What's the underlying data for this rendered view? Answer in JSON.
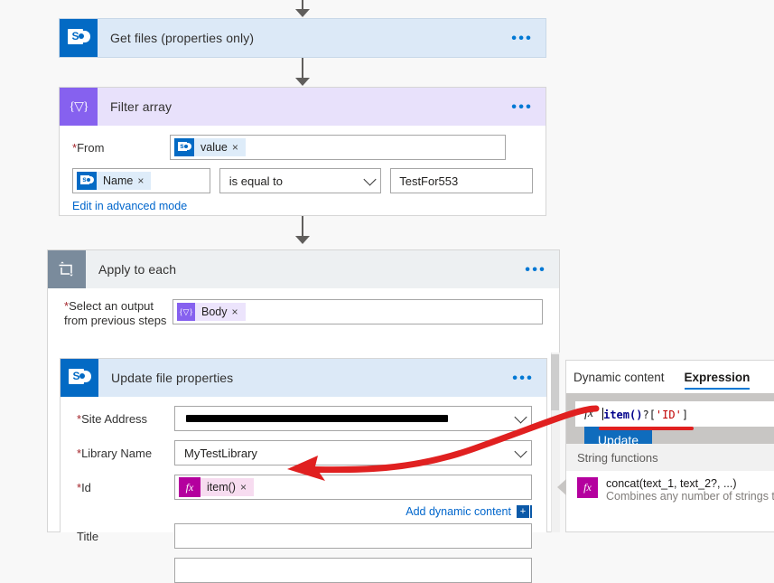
{
  "flow": {
    "steps": [
      {
        "id": "get-files",
        "title": "Get files (properties only)",
        "icon": "sharepoint-icon",
        "menu": "•••"
      },
      {
        "id": "filter-array",
        "title": "Filter array",
        "icon": "filter-array-icon",
        "menu": "•••",
        "from_label": "From",
        "from_required": "*",
        "from_chip": {
          "icon": "sharepoint-icon",
          "label": "value",
          "remove": "×"
        },
        "condition": {
          "left_chip": {
            "icon": "sharepoint-icon",
            "label": "Name",
            "remove": "×"
          },
          "operator": "is equal to",
          "operator_icon": "chevron-down-icon",
          "value": "TestFor553"
        },
        "advanced_link": "Edit in advanced mode"
      },
      {
        "id": "apply-to-each",
        "title": "Apply to each",
        "icon": "loop-icon",
        "menu": "•••",
        "select_label_line1": "Select an output",
        "select_label_line2": "from previous steps",
        "select_required": "*",
        "select_chip": {
          "icon": "filter-array-icon",
          "label": "Body",
          "remove": "×"
        }
      },
      {
        "id": "update-file-properties",
        "title": "Update file properties",
        "icon": "sharepoint-icon",
        "menu": "•••",
        "fields": [
          {
            "label": "Site Address",
            "required": "*",
            "value": "",
            "redacted": true,
            "control": "dropdown",
            "control_icon": "chevron-down-icon"
          },
          {
            "label": "Library Name",
            "required": "*",
            "value": "MyTestLibrary",
            "redacted": false,
            "control": "dropdown",
            "control_icon": "chevron-down-icon"
          },
          {
            "label": "Id",
            "required": "*",
            "value": "",
            "redacted": false,
            "control": "token",
            "token": {
              "icon": "fx-icon",
              "label": "item()",
              "remove": "×"
            }
          },
          {
            "label": "Title",
            "required": "",
            "value": "",
            "redacted": false,
            "control": "text"
          },
          {
            "label": "",
            "required": "",
            "value": "",
            "redacted": false,
            "control": "text"
          }
        ],
        "add_dynamic_content": "Add dynamic content",
        "add_dynamic_content_icon": "add-plus-icon"
      }
    ]
  },
  "panel": {
    "tabs": [
      {
        "label": "Dynamic content",
        "active": false
      },
      {
        "label": "Expression",
        "active": true
      }
    ],
    "expression": {
      "fx_icon": "fx-icon",
      "full_text": "item()?['ID']",
      "tokens": [
        {
          "text": "item()",
          "kind": "function"
        },
        {
          "text": "?[",
          "kind": "punctuation"
        },
        {
          "text": "'ID'",
          "kind": "string"
        },
        {
          "text": "]",
          "kind": "punctuation"
        }
      ]
    },
    "update_button": "Update",
    "section_header": "String functions",
    "functions": [
      {
        "icon": "fx-icon",
        "signature": "concat(text_1, text_2?, ...)",
        "description": "Combines any number of strings toget"
      }
    ]
  },
  "annotations": {
    "arrow_color": "#e02020",
    "underline_color": "#e02020"
  },
  "colors": {
    "sharepoint_blue": "#036ac4",
    "flow_purple": "#8661ef",
    "loop_gray": "#7a8b9c",
    "fx_magenta": "#b4009e",
    "link_blue": "#0066cc",
    "primary_button": "#0f6cbd",
    "required_red": "#a4262c",
    "annotation_red": "#e02020"
  }
}
